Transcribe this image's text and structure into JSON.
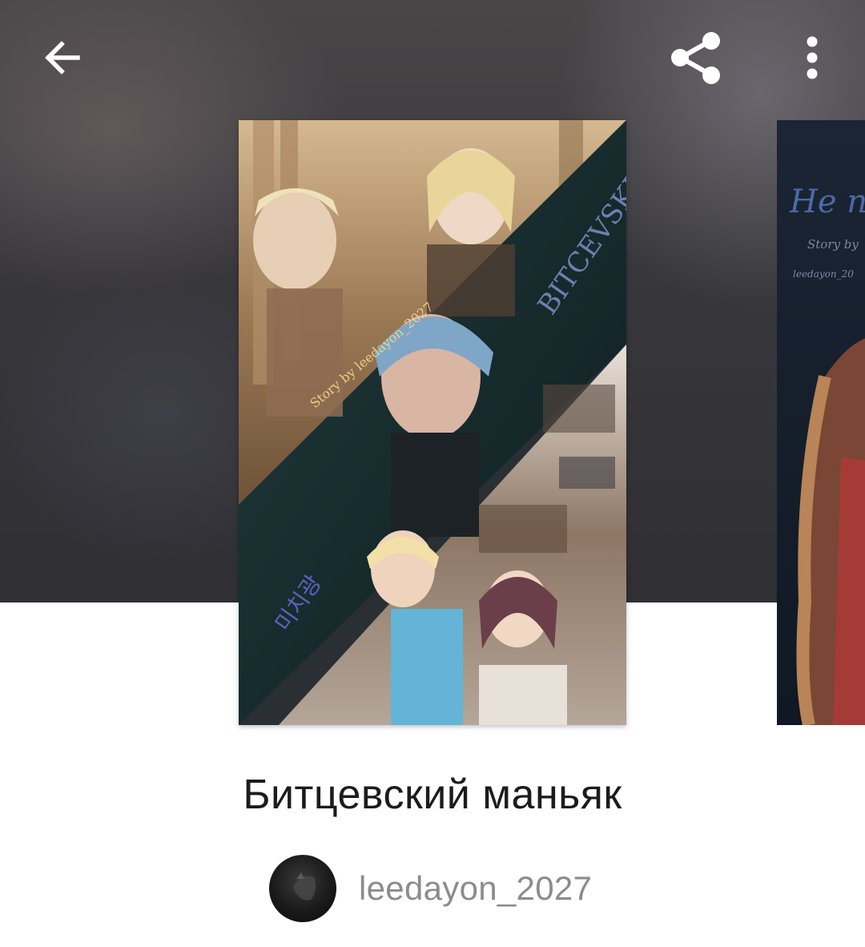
{
  "header": {
    "icons": {
      "back": "arrow-left-icon",
      "share": "share-icon",
      "more": "more-vertical-icon"
    },
    "icon_color": "#ffffff"
  },
  "covers": [
    {
      "title_text_on_image": "BITCEVSKIY",
      "subtitle_text_on_image": "Story by leedayon_2027",
      "korean_text_on_image": "미치광"
    },
    {
      "title_text_on_image": "Не п",
      "subtitle_text_on_image": "Story by",
      "author_text_on_image": "leedayon_20"
    }
  ],
  "story": {
    "title": "Битцевский маньяк",
    "author": "leedayon_2027"
  },
  "colors": {
    "title": "#1c1c1c",
    "author": "#8c8c8c",
    "backdrop": "#38373b"
  }
}
